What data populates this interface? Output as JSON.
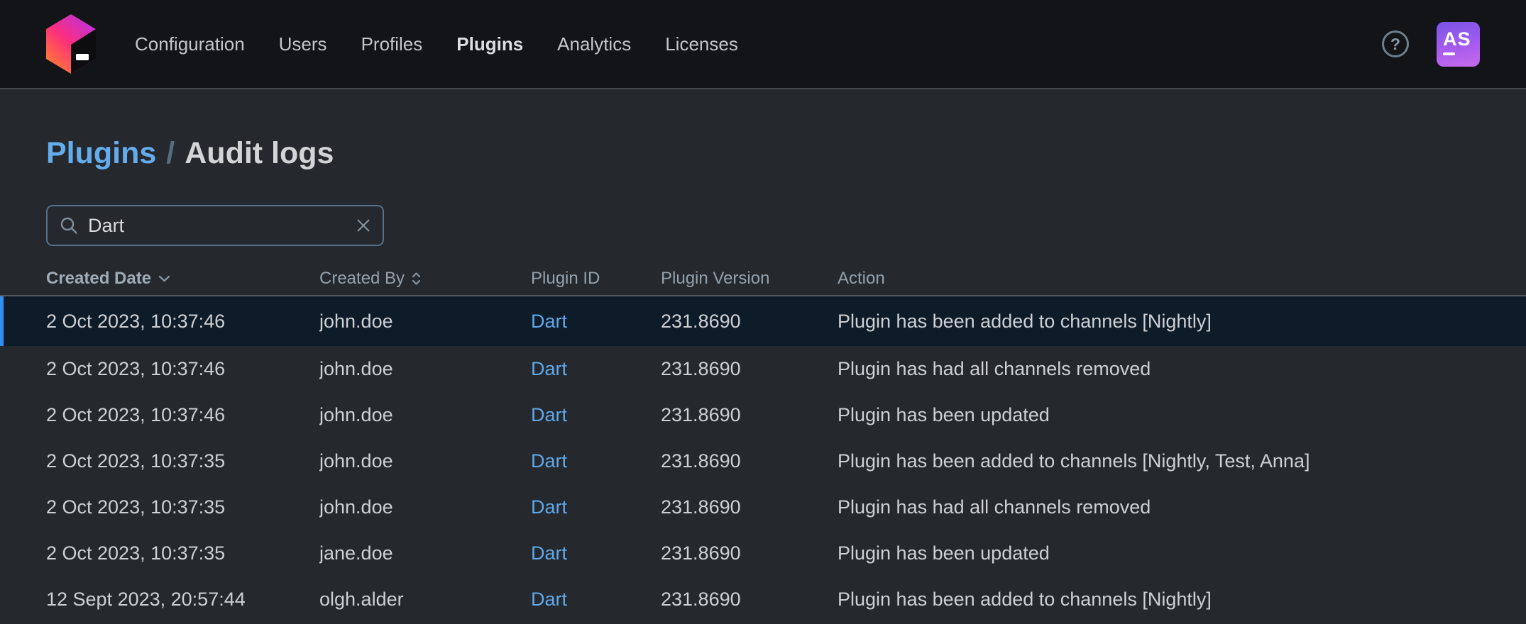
{
  "nav": {
    "items": [
      {
        "label": "Configuration",
        "active": false
      },
      {
        "label": "Users",
        "active": false
      },
      {
        "label": "Profiles",
        "active": false
      },
      {
        "label": "Plugins",
        "active": true
      },
      {
        "label": "Analytics",
        "active": false
      },
      {
        "label": "Licenses",
        "active": false
      }
    ],
    "help_glyph": "?",
    "avatar_initials": "AS"
  },
  "breadcrumb": {
    "parent": "Plugins",
    "separator": "/",
    "current": "Audit logs"
  },
  "search": {
    "value": "Dart",
    "placeholder": ""
  },
  "table": {
    "columns": [
      {
        "label": "Created Date",
        "sort": "desc",
        "sortable": true
      },
      {
        "label": "Created By",
        "sort": "none",
        "sortable": true
      },
      {
        "label": "Plugin ID",
        "sortable": false
      },
      {
        "label": "Plugin Version",
        "sortable": false
      },
      {
        "label": "Action",
        "sortable": false
      }
    ],
    "rows": [
      {
        "created_date": "2 Oct 2023, 10:37:46",
        "created_by": "john.doe",
        "plugin_id": "Dart",
        "plugin_version": "231.8690",
        "action": "Plugin has been added to channels [Nightly]",
        "selected": true
      },
      {
        "created_date": "2 Oct 2023, 10:37:46",
        "created_by": "john.doe",
        "plugin_id": "Dart",
        "plugin_version": "231.8690",
        "action": "Plugin has had all channels removed",
        "selected": false
      },
      {
        "created_date": "2 Oct 2023, 10:37:46",
        "created_by": "john.doe",
        "plugin_id": "Dart",
        "plugin_version": "231.8690",
        "action": "Plugin has been updated",
        "selected": false
      },
      {
        "created_date": "2 Oct 2023, 10:37:35",
        "created_by": "john.doe",
        "plugin_id": "Dart",
        "plugin_version": "231.8690",
        "action": "Plugin has been added to channels [Nightly, Test, Anna]",
        "selected": false
      },
      {
        "created_date": "2 Oct 2023, 10:37:35",
        "created_by": "john.doe",
        "plugin_id": "Dart",
        "plugin_version": "231.8690",
        "action": "Plugin has had all channels removed",
        "selected": false
      },
      {
        "created_date": "2 Oct 2023, 10:37:35",
        "created_by": "jane.doe",
        "plugin_id": "Dart",
        "plugin_version": "231.8690",
        "action": "Plugin has been updated",
        "selected": false
      },
      {
        "created_date": "12 Sept 2023, 20:57:44",
        "created_by": "olgh.alder",
        "plugin_id": "Dart",
        "plugin_version": "231.8690",
        "action": "Plugin has been added to channels [Nightly]",
        "selected": false
      }
    ]
  },
  "colors": {
    "topnav_bg": "#121417",
    "content_bg": "#25282d",
    "accent_blue": "#3090f2",
    "link_blue": "#5fa8ea",
    "breadcrumb_blue": "#64acec",
    "selected_row_bg": "#0e1b29",
    "search_border": "#567188",
    "avatar_gradient_start": "#7a55e8",
    "avatar_gradient_end": "#c76aec",
    "logo_gradient": [
      "#ff9419",
      "#fc2e7f",
      "#a934f7"
    ]
  }
}
